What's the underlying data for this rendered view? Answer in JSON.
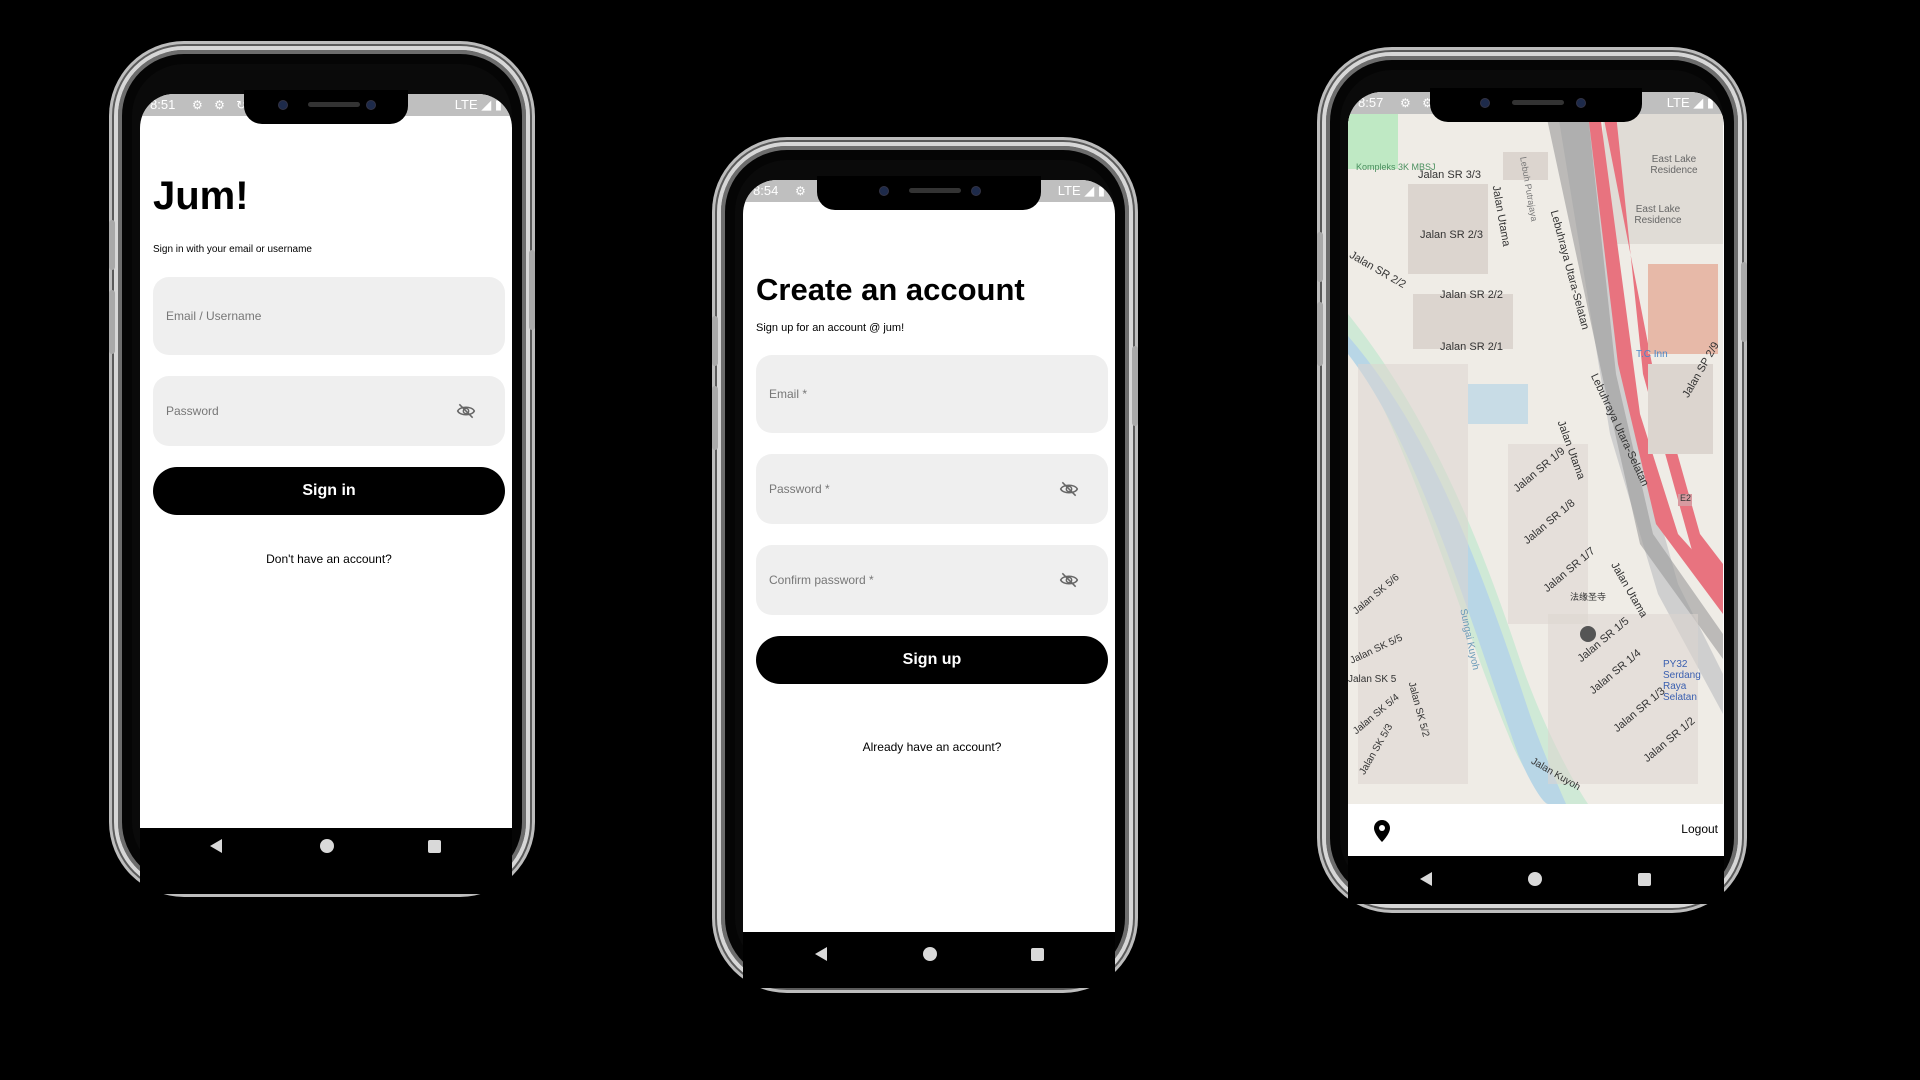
{
  "colors": {
    "background": "#000000",
    "button": "#000000",
    "field": "#efefef",
    "highway": "#e8737f",
    "river": "#b8d6e6",
    "park": "#bfe9c4"
  },
  "signin": {
    "status_time": "8:51",
    "status_network": "LTE",
    "title": "Jum!",
    "subtitle": "Sign in with your email or username",
    "email_placeholder": "Email / Username",
    "password_placeholder": "Password",
    "submit_label": "Sign in",
    "alt_link": "Don't have an account?",
    "icons": [
      "settings-icon",
      "eye-off-icon",
      "back-icon",
      "home-icon",
      "recents-icon"
    ]
  },
  "signup": {
    "status_time": "8:54",
    "status_network": "LTE",
    "title": "Create an account",
    "subtitle": "Sign up for an account @ jum!",
    "email_placeholder": "Email *",
    "password_placeholder": "Password *",
    "confirm_placeholder": "Confirm password *",
    "submit_label": "Sign up",
    "alt_link": "Already have an account?"
  },
  "map": {
    "status_time": "8:57",
    "status_network": "LTE",
    "logout_label": "Logout",
    "labels": {
      "sr33": "Jalan SR 3/3",
      "sr23": "Jalan SR 2/3",
      "sr22a": "Jalan SR 2/2",
      "sr22b": "Jalan SR 2/2",
      "sr21": "Jalan SR 2/1",
      "sr19": "Jalan SR 1/9",
      "sr18": "Jalan SR 1/8",
      "sr17": "Jalan SR 1/7",
      "sr15": "Jalan SR 1/5",
      "sr14": "Jalan SR 1/4",
      "sr13": "Jalan SR 1/3",
      "sr12": "Jalan SR 1/2",
      "utama1": "Jalan Utama",
      "utama2": "Jalan Utama",
      "utama3": "Jalan Utama",
      "putrajaya": "Lebuh Putrajaya",
      "lebuhraya1": "Lebuhraya Utara-Selatan",
      "lebuhraya2": "Lebuhraya Utara-Selatan",
      "eastlake1": "East Lake Residence",
      "eastlake2": "East Lake Residence",
      "kompleks": "Kompleks 3K MBSJ",
      "tcinn": "T.C Inn",
      "sp29": "Jalan SP 2/9",
      "sungai": "Sungai Kuyoh",
      "py32": "PY32 Serdang Raya Selatan",
      "temple": "法缘圣寺",
      "sk56": "Jalan SK 5/6",
      "sk55": "Jalan SK 5/5",
      "sk5": "Jalan SK 5",
      "sk54": "Jalan SK 5/4",
      "sk53": "Jalan SK 5/3",
      "sk52": "Jalan SK 5/2",
      "kuyoh": "Jalan Kuyoh",
      "e2": "E2"
    }
  }
}
